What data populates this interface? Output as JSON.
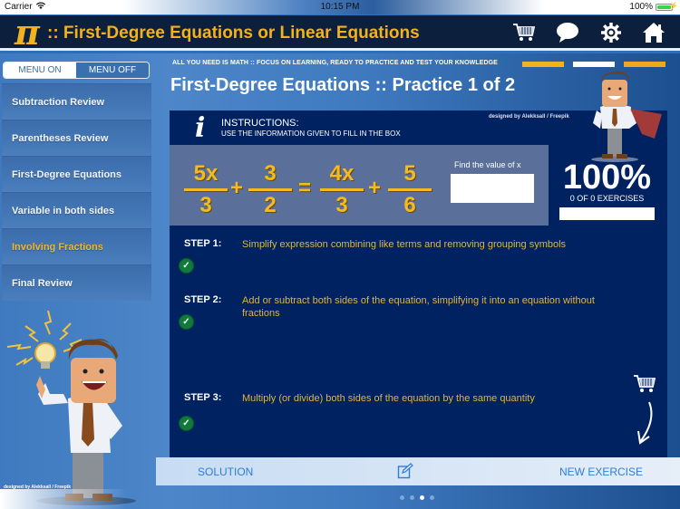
{
  "status_bar": {
    "carrier": "Carrier",
    "time": "10:15 PM",
    "battery": "100%",
    "battery_level": 1.0
  },
  "header": {
    "logo_symbol": "π",
    "title": ":: First-Degree Equations or Linear Equations",
    "icons": [
      "cart-icon",
      "chat-bubble-icon",
      "gear-icon",
      "home-icon"
    ]
  },
  "menu_toggle": {
    "on_label": "MENU ON",
    "off_label": "MENU OFF",
    "selected": "MENU ON"
  },
  "sidebar": {
    "items": [
      {
        "label": "Subtraction Review",
        "active": false
      },
      {
        "label": "Parentheses Review",
        "active": false
      },
      {
        "label": "First-Degree Equations",
        "active": false
      },
      {
        "label": "Variable in both sides",
        "active": false
      },
      {
        "label": "Involving Fractions",
        "active": true
      },
      {
        "label": "Final Review",
        "active": false
      }
    ],
    "credit": "designed by Alekksall / Freepik"
  },
  "tagline": "ALL YOU NEED IS MATH :: FOCUS ON LEARNING, READY TO PRACTICE AND TEST YOUR KNOWLEDGE",
  "accent_bars": [
    "#f1b21d",
    "#ffffff",
    "#f0a81a"
  ],
  "page_title": "First-Degree Equations :: Practice 1 of 2",
  "instructions": {
    "heading": "INSTRUCTIONS:",
    "text": "USE THE INFORMATION GIVEN TO FILL IN THE BOX",
    "credit": "designed by Alekksall / Freepik"
  },
  "equation": {
    "terms": [
      {
        "num": "5x",
        "den": "3"
      },
      {
        "op": "+"
      },
      {
        "num": "3",
        "den": "2"
      },
      {
        "op": "="
      },
      {
        "num": "4x",
        "den": "3"
      },
      {
        "op": "+"
      },
      {
        "num": "5",
        "den": "6"
      }
    ],
    "ops": [
      "+",
      "=",
      "+"
    ],
    "fractions": [
      {
        "num": "5x",
        "den": "3"
      },
      {
        "num": "3",
        "den": "2"
      },
      {
        "num": "4x",
        "den": "3"
      },
      {
        "num": "5",
        "den": "6"
      }
    ]
  },
  "answer": {
    "label": "Find the value of x",
    "value": "",
    "placeholder": ""
  },
  "score": {
    "percent_label": "100%",
    "subtitle": "0 OF 0 EXERCISES",
    "progress": 1.0
  },
  "steps": [
    {
      "label": "STEP 1:",
      "text": "Simplify expression combining like terms and removing grouping symbols",
      "done": true
    },
    {
      "label": "STEP 2:",
      "text": "Add or subtract both sides of the equation, simplifying it into an equation without fractions",
      "done": true
    },
    {
      "label": "STEP 3:",
      "text": "Multiply (or divide) both sides of the equation by the same quantity",
      "done": true
    }
  ],
  "check_glyph": "✓",
  "bottom_bar": {
    "solution_label": "SOLUTION",
    "new_exercise_label": "NEW EXERCISE"
  },
  "page_dots": {
    "count": 4,
    "active": 3
  },
  "colors": {
    "header_bg": "#0c1f3d",
    "accent_gold": "#f1b21d",
    "panel_bg": "#002261",
    "equation_bg": "#5a6f99",
    "step_text": "#e3b43a",
    "check_green": "#0f7a3b",
    "link_blue": "#2f7cd9"
  }
}
